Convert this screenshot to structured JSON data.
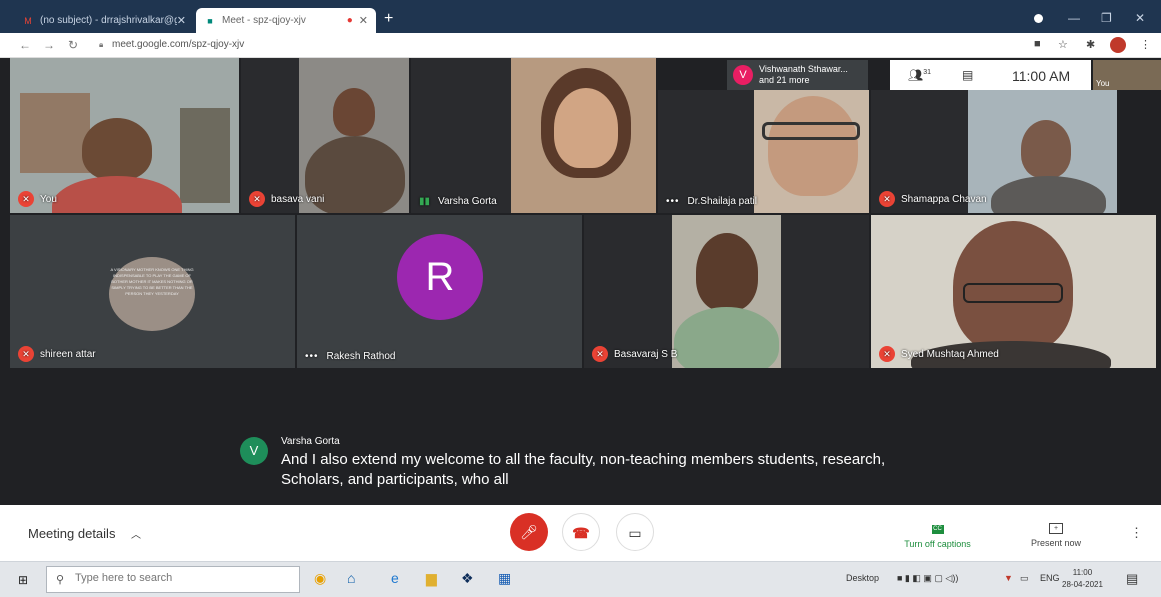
{
  "browser": {
    "tabs": [
      {
        "title": "(no subject) - drrajshrivalkar@gm",
        "icon": "gmail-icon"
      },
      {
        "title": "Meet - spz-qjoy-xjv",
        "icon": "meet-icon",
        "active": true
      }
    ],
    "new_tab": "+",
    "address": "meet.google.com/spz-qjoy-xjv"
  },
  "meet": {
    "participants": [
      {
        "name": "You",
        "muted": true
      },
      {
        "name": "basava vani",
        "muted": true
      },
      {
        "name": "Varsha Gorta",
        "speaking": true
      },
      {
        "name": "Dr.Shailaja patil",
        "muted": false
      },
      {
        "name": "Shamappa Chavan",
        "muted": true
      },
      {
        "name": "shireen attar",
        "muted": true
      },
      {
        "name": "Rakesh Rathod",
        "muted": false
      },
      {
        "name": "Basavaraj S B",
        "muted": true
      },
      {
        "name": "Syed Mushtaq Ahmed",
        "muted": true
      }
    ],
    "overlay": {
      "avatar_letter": "V",
      "line1": "Vishwanath Sthawar...",
      "line2": "and 21 more"
    },
    "people_count": "31",
    "time": "11:00 AM",
    "self_label": "You",
    "avatar_letter_r": "R",
    "quote_text": "A VISIONARY MOTHER KNOWS ONE THING INDISPENSABLE TO PLAY THE GAME OF BOTHER MOTHER IT MAKES NOTHING OR SIMPLY TRYING TO BE BETTER THAN THE PERSON THEY YESTERDAY",
    "caption": {
      "speaker_letter": "V",
      "speaker": "Varsha Gorta",
      "text": "And I also extend my welcome to all the faculty, non-teaching members students, research, Scholars, and participants, who all"
    },
    "controls": {
      "meeting_details": "Meeting details",
      "turn_off_captions": "Turn off captions",
      "present_now": "Present now"
    }
  },
  "taskbar": {
    "search_placeholder": "Type here to search",
    "desktop_label": "Desktop",
    "language": "ENG",
    "clock_time": "11:00",
    "clock_date": "28-04-2021"
  },
  "colors": {
    "meet_background": "#202124",
    "danger_red": "#ea4335",
    "caption_green": "#1e8e3e",
    "avatar_purple": "#9c27b0"
  }
}
